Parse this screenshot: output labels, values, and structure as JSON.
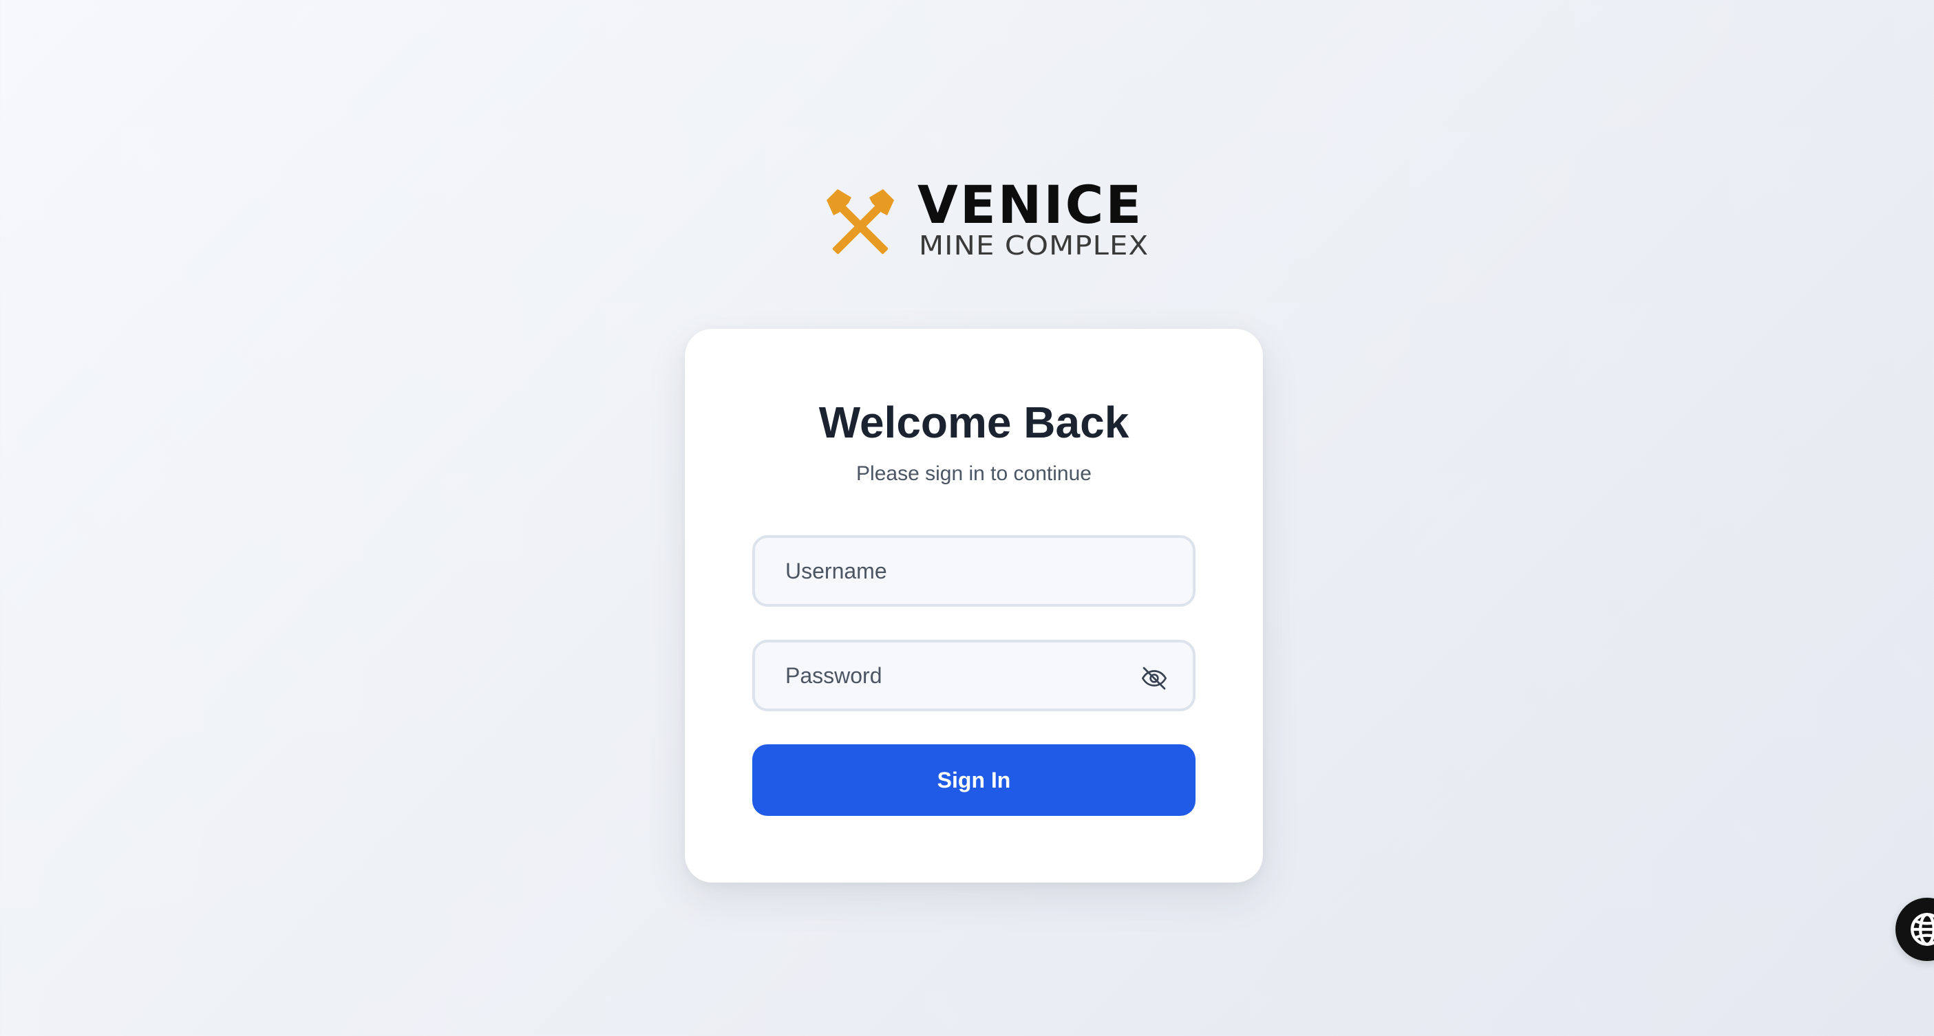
{
  "brand": {
    "name": "VENICE",
    "tagline": "MINE COMPLEX",
    "accent_color": "#e89b22",
    "logo_icon": "crossed-hammers-icon"
  },
  "login": {
    "title": "Welcome Back",
    "subtitle": "Please sign in to continue",
    "username": {
      "placeholder": "Username",
      "value": ""
    },
    "password": {
      "placeholder": "Password",
      "value": "",
      "toggle_icon": "eye-off-icon"
    },
    "submit_label": "Sign In",
    "submit_color": "#1f5be6"
  },
  "widget": {
    "icon": "globe-icon"
  }
}
